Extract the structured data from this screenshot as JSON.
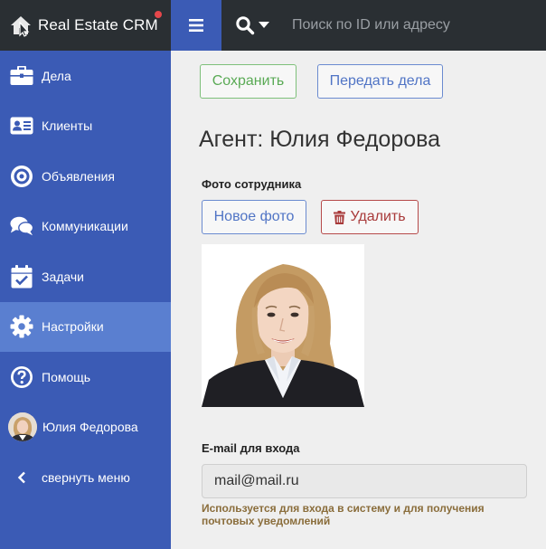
{
  "app": {
    "brand": "Real Estate CRM"
  },
  "search": {
    "placeholder": "Поиск по ID или адресу"
  },
  "sidebar": {
    "items": [
      {
        "label": "Дела",
        "icon": "briefcase-icon"
      },
      {
        "label": "Клиенты",
        "icon": "id-card-icon"
      },
      {
        "label": "Объявления",
        "icon": "target-icon"
      },
      {
        "label": "Коммуникации",
        "icon": "chat-bubbles-icon"
      },
      {
        "label": "Задачи",
        "icon": "calendar-check-icon"
      },
      {
        "label": "Настройки",
        "icon": "gear-icon",
        "active": true
      },
      {
        "label": "Помощь",
        "icon": "question-circle-icon"
      },
      {
        "label": "Юлия Федорова",
        "icon": "avatar"
      },
      {
        "label": "свернуть меню",
        "icon": "chevron-left-icon"
      }
    ]
  },
  "toolbar": {
    "save_label": "Сохранить",
    "transfer_label": "Передать дела"
  },
  "page": {
    "title": "Агент: Юлия Федорова"
  },
  "photo_section": {
    "label": "Фото сотрудника",
    "new_photo_label": "Новое фото",
    "delete_label": "Удалить"
  },
  "email_section": {
    "label": "E-mail для входа",
    "value": "mail@mail.ru",
    "hint": "Используется для входа в систему и для получения почтовых уведомлений"
  },
  "colors": {
    "topbar": "#2a2f33",
    "sidebar": "#3b5bb5",
    "sidebar_active": "#5a7fd0",
    "success": "#5aaa55",
    "primary": "#5074c5",
    "danger": "#a83a3a",
    "notification_dot": "#e5474b"
  }
}
